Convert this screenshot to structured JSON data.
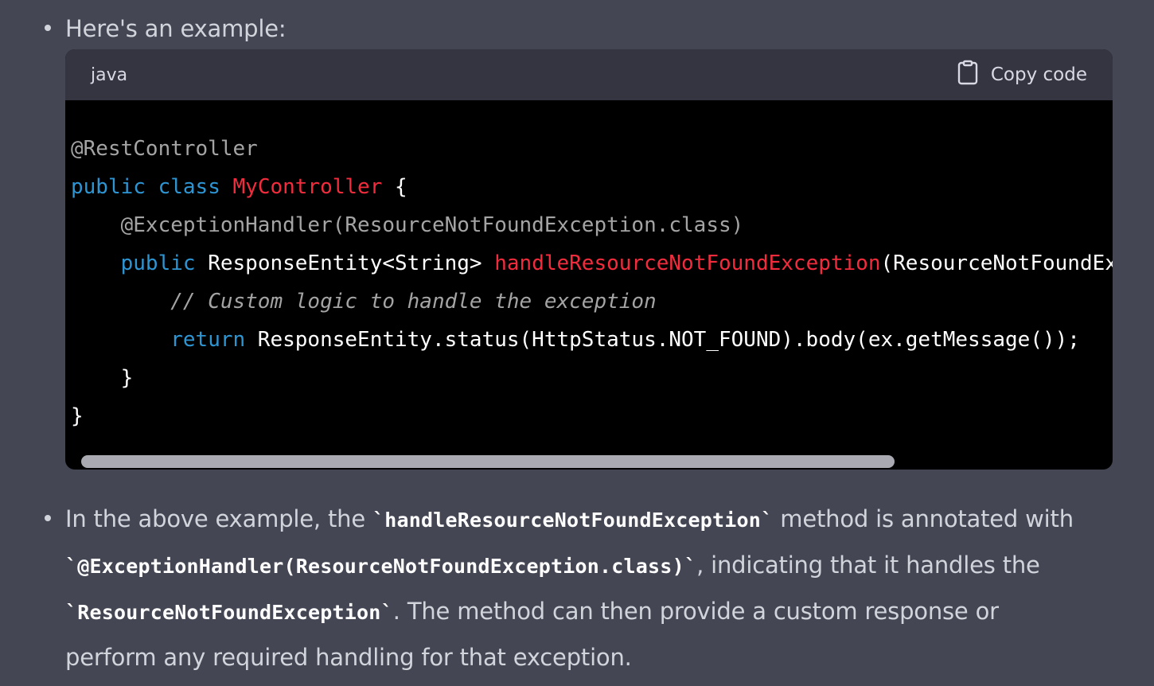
{
  "bullets": {
    "first": {
      "text": "Here's an example:"
    },
    "second": {
      "line1_pre": "In the above example, the ",
      "line1_code": "`handleResourceNotFoundException`",
      "line1_post": " method is annotated with",
      "line2_code": "`@ExceptionHandler(ResourceNotFoundException.class)`",
      "line2_post": ", indicating that it handles the",
      "line3_code": "`ResourceNotFoundException`",
      "line3_post": ". The method can then provide a custom response or",
      "line4": "perform any required handling for that exception."
    }
  },
  "code_block": {
    "language": "java",
    "copy_label": "Copy code",
    "lines": {
      "l1_anno": "@RestController",
      "l2_kw1": "public",
      "l2_kw2": "class",
      "l2_cls": "MyController",
      "l2_rest": " {",
      "l3_indent": "    ",
      "l3_anno": "@ExceptionHandler(ResourceNotFoundException.class)",
      "l4_indent": "    ",
      "l4_kw": "public",
      "l4_type": " ResponseEntity<String> ",
      "l4_fn": "handleResourceNotFoundException",
      "l4_rest": "(ResourceNotFoundException ex) {",
      "l5_indent": "        ",
      "l5_comment": "// Custom logic to handle the exception",
      "l6_indent": "        ",
      "l6_kw": "return",
      "l6_rest": " ResponseEntity.status(HttpStatus.NOT_FOUND).body(ex.getMessage());",
      "l7": "    }",
      "l8": "}"
    }
  },
  "colors": {
    "page_bg": "#444654",
    "code_header_bg": "#343541",
    "code_bg": "#000000",
    "keyword": "#2e95d3",
    "function": "#f22c3d",
    "annotation": "#a4a4a4"
  }
}
